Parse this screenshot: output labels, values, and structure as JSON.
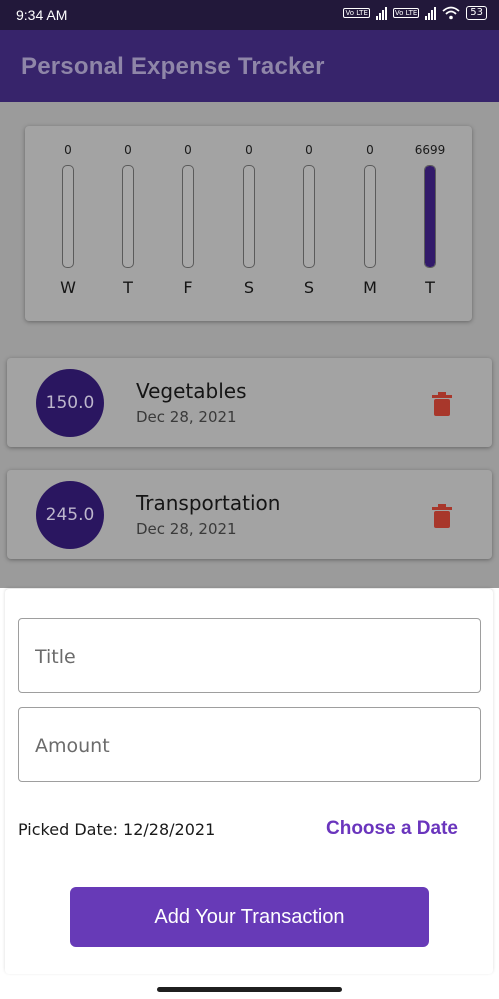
{
  "status_bar": {
    "time": "9:34 AM",
    "volte_1": "Vo LTE",
    "volte_2": "Vo LTE",
    "battery": "53"
  },
  "app_bar": {
    "title": "Personal Expense Tracker"
  },
  "chart_data": {
    "type": "bar",
    "categories": [
      "W",
      "T",
      "F",
      "S",
      "S",
      "M",
      "T"
    ],
    "values": [
      0,
      0,
      0,
      0,
      0,
      0,
      6699
    ],
    "value_labels": [
      "0",
      "0",
      "0",
      "0",
      "0",
      "0",
      "6699"
    ],
    "colors": {
      "fill": "#321a6a",
      "track": "#a8a8a8"
    }
  },
  "transactions": [
    {
      "amount": "150.0",
      "title": "Vegetables",
      "date": "Dec 28, 2021",
      "delete_icon": "trash-icon"
    },
    {
      "amount": "245.0",
      "title": "Transportation",
      "date": "Dec 28, 2021",
      "delete_icon": "trash-icon"
    }
  ],
  "form": {
    "title_placeholder": "Title",
    "amount_placeholder": "Amount",
    "picked_date": "Picked Date: 12/28/2021",
    "choose_date": "Choose a Date",
    "submit_label": "Add Your Transaction"
  },
  "colors": {
    "accent": "#673ab7",
    "app_bar": "#37246b",
    "delete": "#c0392b",
    "avatar": "#2a1660"
  }
}
